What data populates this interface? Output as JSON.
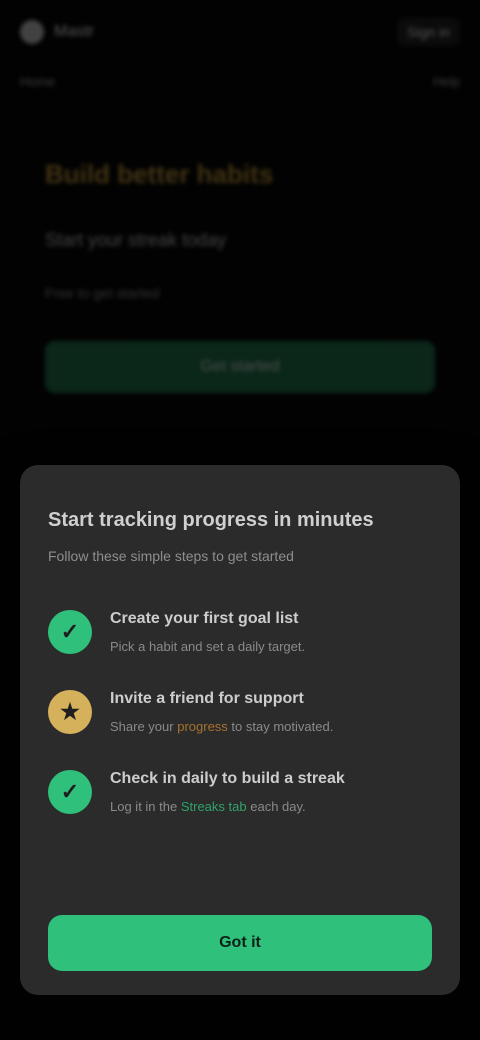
{
  "app": {
    "brand_name": "Mastr",
    "top_action": "Sign in",
    "subnav_left": "Home",
    "subnav_right": "Help"
  },
  "hero": {
    "title": "Build better habits",
    "subtitle": "Start your streak today",
    "meta": "Free to get started",
    "cta": "Get started"
  },
  "modal": {
    "title": "Start tracking progress in minutes",
    "subtitle": "Follow these simple steps to get started",
    "steps": [
      {
        "icon": "check",
        "color": "#2fc07b",
        "title": "Create your first goal list",
        "desc": "Pick a habit and set a daily target."
      },
      {
        "icon": "star",
        "color": "#d6b15c",
        "title": "Invite a friend for support",
        "desc_prefix": "Share your",
        "desc_highlight": "progress",
        "desc_suffix": "to stay motivated."
      },
      {
        "icon": "check",
        "color": "#2fc07b",
        "title": "Check in daily to build a streak",
        "desc_prefix": "Log it in the",
        "desc_highlight": "Streaks tab",
        "desc_suffix": "each day."
      }
    ],
    "button_label": "Got it"
  },
  "colors": {
    "background": "#050505",
    "modal_bg": "#2b2b2b",
    "accent_green": "#2fc07b",
    "accent_gold": "#d6b15c"
  }
}
